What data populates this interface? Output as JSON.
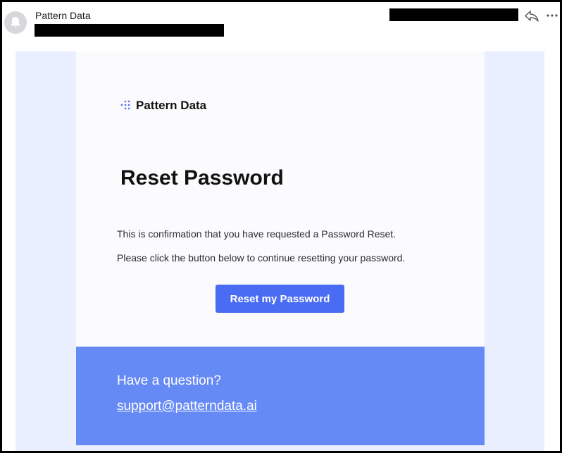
{
  "header": {
    "sender_name": "Pattern Data",
    "avatar_icon": "bell-icon",
    "actions": [
      {
        "icon": "reply-icon"
      },
      {
        "icon": "more-options-icon"
      }
    ]
  },
  "email": {
    "brand": {
      "logo_icon": "dot-grid-logo-icon",
      "name": "Pattern Data",
      "logo_color": "#4a6cf2"
    },
    "heading": "Reset Password",
    "paragraphs": [
      "This is confirmation that you have requested a Password Reset.",
      "Please click the button below to continue resetting your password."
    ],
    "cta_label": "Reset my Password",
    "footer": {
      "question": "Have a question?",
      "support_email": "support@patterndata.ai"
    }
  },
  "colors": {
    "accent": "#4a6cf2",
    "footer_bg": "#6589f5",
    "outer_bg": "#e9efff"
  }
}
